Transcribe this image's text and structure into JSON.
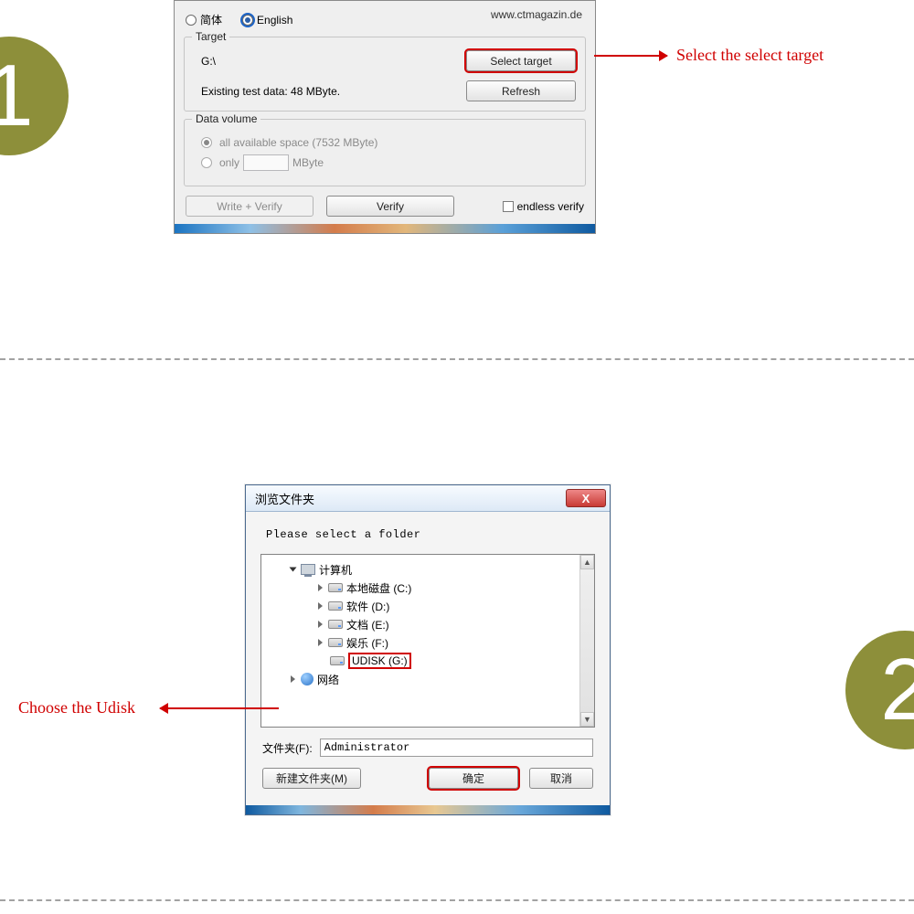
{
  "steps": {
    "one": "1",
    "two": "2"
  },
  "annotations": {
    "select_target": "Select the select target",
    "choose_udisk": "Choose the Udisk"
  },
  "panel1": {
    "lang_cn": "简体",
    "lang_en": "English",
    "url": "www.ctmagazin.de",
    "target": {
      "legend": "Target",
      "path": "G:\\",
      "existing": "Existing test data: 48 MByte.",
      "select_btn": "Select target",
      "refresh_btn": "Refresh"
    },
    "dv": {
      "legend": "Data volume",
      "all": "all available space (7532 MByte)",
      "only": "only",
      "unit": "MByte"
    },
    "actions": {
      "write_verify": "Write + Verify",
      "verify": "Verify",
      "endless": "endless verify"
    }
  },
  "panel2": {
    "title": "浏览文件夹",
    "close": "X",
    "prompt": "Please select a folder",
    "tree": {
      "computer": "计算机",
      "drives": {
        "c": "本地磁盘 (C:)",
        "d": "软件 (D:)",
        "e": "文档 (E:)",
        "f": "娱乐 (F:)",
        "g": "UDISK (G:)"
      },
      "network": "网络"
    },
    "folder_label": "文件夹(F):",
    "folder_value": "Administrator",
    "buttons": {
      "new": "新建文件夹(M)",
      "ok": "确定",
      "cancel": "取消"
    }
  }
}
